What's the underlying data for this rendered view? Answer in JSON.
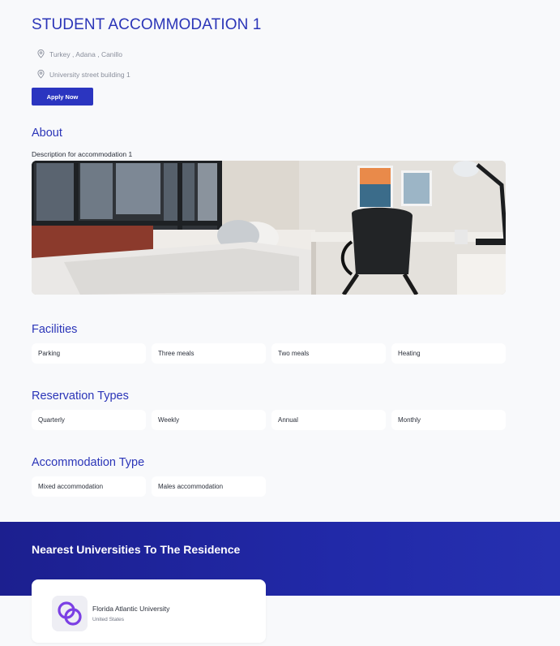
{
  "header": {
    "title": "STUDENT ACCOMMODATION 1",
    "location": "Turkey , Adana , Canillo",
    "address": "University street building 1",
    "apply_label": "Apply Now"
  },
  "about": {
    "title": "About",
    "description": "Description for accommodation 1"
  },
  "facilities": {
    "title": "Facilities",
    "items": [
      "Parking",
      "Three meals",
      "Two meals",
      "Heating"
    ]
  },
  "reservation_types": {
    "title": "Reservation Types",
    "items": [
      "Quarterly",
      "Weekly",
      "Annual",
      "Monthly"
    ]
  },
  "accommodation_type": {
    "title": "Accommodation Type",
    "items": [
      "Mixed accommodation",
      "Males accommodation"
    ]
  },
  "universities": {
    "title": "Nearest Universities To The Residence",
    "items": [
      {
        "name": "Florida Atlantic University",
        "country": "United States"
      }
    ]
  },
  "colors": {
    "accent": "#2b35b8",
    "band": "#1c1f8f",
    "logo": "#7b3fe4"
  },
  "icons": [
    "map-pin-icon",
    "university-logo-icon"
  ]
}
